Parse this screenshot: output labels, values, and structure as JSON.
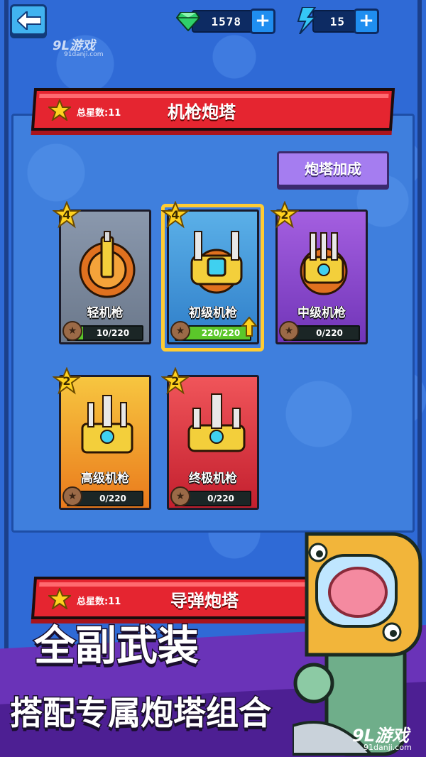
{
  "topbar": {
    "gems": "1578",
    "energy": "15",
    "plus": "+"
  },
  "watermark": {
    "logo": "9L游戏",
    "site": "91danji.com"
  },
  "section_machine_gun": {
    "stars_label": "总星数:11",
    "title": "机枪炮塔",
    "boost_button": "炮塔加成",
    "cards": [
      {
        "name": "轻机枪",
        "stars": "4",
        "progress": "10/220",
        "fill": 0.05,
        "theme": "grey",
        "selected": false
      },
      {
        "name": "初级机枪",
        "stars": "4",
        "progress": "220/220",
        "fill": 1.0,
        "theme": "blue",
        "selected": true
      },
      {
        "name": "中级机枪",
        "stars": "2",
        "progress": "0/220",
        "fill": 0,
        "theme": "purple",
        "selected": false
      },
      {
        "name": "高级机枪",
        "stars": "2",
        "progress": "0/220",
        "fill": 0,
        "theme": "orange",
        "selected": false
      },
      {
        "name": "终极机枪",
        "stars": "2",
        "progress": "0/220",
        "fill": 0,
        "theme": "red",
        "selected": false
      }
    ]
  },
  "section_missile": {
    "stars_label": "总星数:11",
    "title": "导弹炮塔"
  },
  "promo": {
    "line1": "全副武装",
    "line2": "搭配专属炮塔组合"
  },
  "colors": {
    "background": "#2f6ad6",
    "ribbon": "#e52530",
    "accent_yellow": "#ffcc33",
    "progress_green": "#5bc72a",
    "promo_purple": "#6a33b8"
  }
}
